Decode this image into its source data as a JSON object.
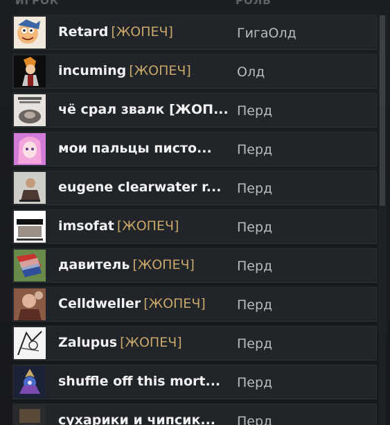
{
  "header": {
    "player_label": "ИГРОК",
    "role_label": "РОЛЬ"
  },
  "players": [
    {
      "name": "Retard",
      "tag": "[ЖОПЕЧ]",
      "role": "ГигаОлд",
      "avatar": "cartoon-face-avatar"
    },
    {
      "name": "incuming",
      "tag": "[ЖОПЕЧ]",
      "role": "Олд",
      "avatar": "anime-character-avatar"
    },
    {
      "name": "чё срал звалк [ЖОП...",
      "tag": "",
      "role": "Перд",
      "avatar": "cat-meme-avatar"
    },
    {
      "name": "мои пальцы писто...",
      "tag": "",
      "role": "Перд",
      "avatar": "pink-anime-avatar"
    },
    {
      "name": "eugene clearwater r...",
      "tag": "",
      "role": "Перд",
      "avatar": "man-photo-avatar"
    },
    {
      "name": "imsofat",
      "tag": "[ЖОПЕЧ]",
      "role": "Перд",
      "avatar": "text-meme-avatar"
    },
    {
      "name": "давитель",
      "tag": "[ЖОПЕЧ]",
      "role": "Перд",
      "avatar": "flag-avatar"
    },
    {
      "name": "Celldweller",
      "tag": "[ЖОПЕЧ]",
      "role": "Перд",
      "avatar": "photo-avatar"
    },
    {
      "name": "Zalupus",
      "tag": "[ЖОПЕЧ]",
      "role": "Перд",
      "avatar": "sketch-avatar"
    },
    {
      "name": "shuffle off this mort...",
      "tag": "",
      "role": "Перд",
      "avatar": "hero-avatar"
    },
    {
      "name": "сухарики и чипсик...",
      "tag": "",
      "role": "Перд",
      "avatar": "dark-avatar"
    }
  ],
  "colors": {
    "tag": "#c9a86a",
    "name": "#f2f2f2",
    "role": "#b8bcc0",
    "row_bg": "#212428"
  }
}
